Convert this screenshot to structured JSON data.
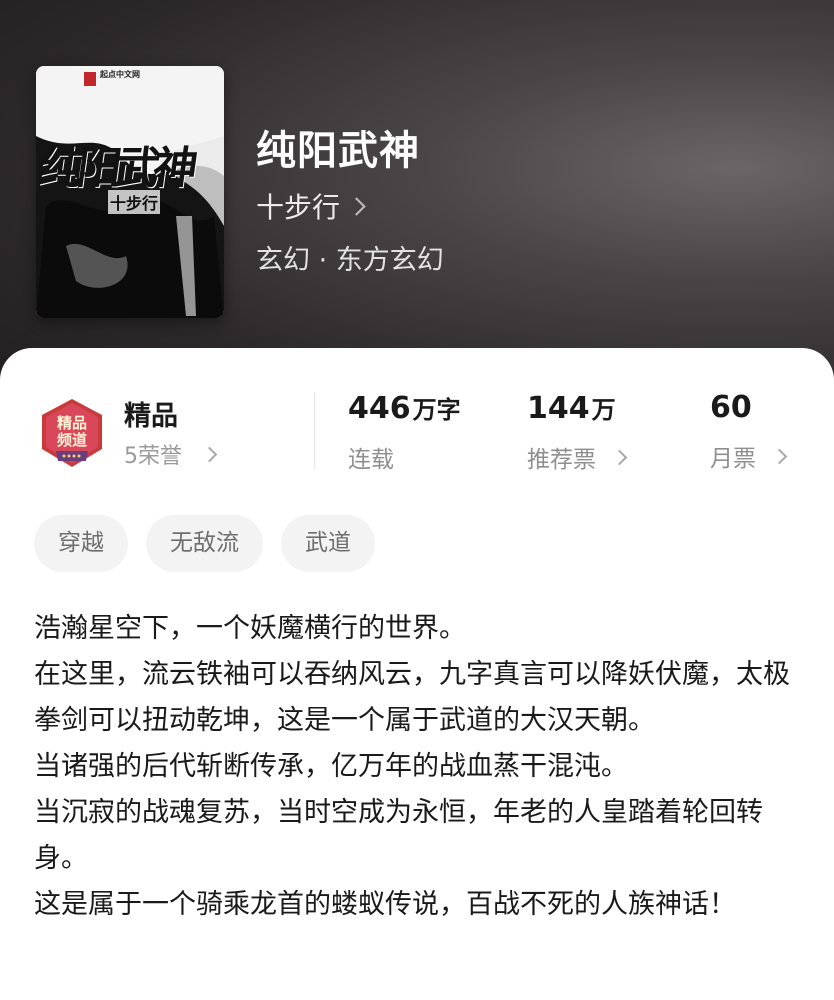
{
  "book": {
    "cover_title": "纯阳武神",
    "cover_author": "十步行",
    "cover_site": "起点中文网",
    "title": "纯阳武神",
    "author": "十步行",
    "genre": "玄幻 · 东方玄幻"
  },
  "stats": {
    "quality": {
      "title": "精品",
      "honor": "5荣誉",
      "medal_text": "精品\n频道"
    },
    "words": {
      "value": "446",
      "unit": "万字",
      "label": "连载"
    },
    "recommend": {
      "value": "144",
      "unit": "万",
      "label": "推荐票"
    },
    "monthly": {
      "value": "60",
      "unit": "",
      "label": "月票"
    }
  },
  "tags": [
    "穿越",
    "无敌流",
    "武道"
  ],
  "description": [
    "浩瀚星空下，一个妖魔横行的世界。",
    "在这里，流云铁袖可以吞纳风云，九字真言可以降妖伏魔，太极拳剑可以扭动乾坤，这是一个属于武道的大汉天朝。",
    "当诸强的后代斩断传承，亿万年的战血蒸干混沌。",
    "当沉寂的战魂复苏，当时空成为永恒，年老的人皇踏着轮回转身。",
    "这是属于一个骑乘龙首的蝼蚁传说，百战不死的人族神话！"
  ],
  "icons": {
    "chevron": "chevron-right-icon",
    "medal": "quality-medal-icon"
  },
  "colors": {
    "header_bg": "#2b2829",
    "medal_red": "#c93a3a",
    "medal_purple": "#6b3c7e",
    "tag_bg": "#f3f3f3"
  }
}
